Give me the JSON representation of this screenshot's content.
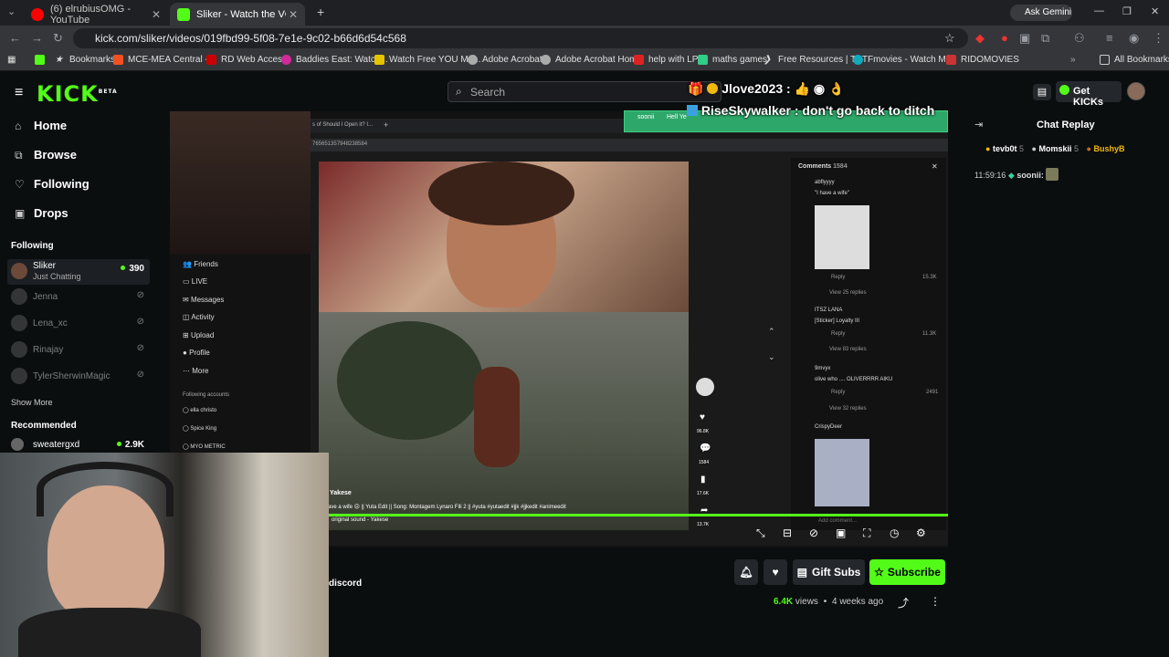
{
  "browser": {
    "tabs": [
      {
        "title": "(6) elrubiusOMG - YouTube",
        "active": false
      },
      {
        "title": "Sliker - Watch the VOD on",
        "active": true
      }
    ],
    "ask_gemini": "Ask Gemini",
    "url": "kick.com/sliker/videos/019fbd99-5f08-7e1e-9c02-b66d6d54c568",
    "bookmarks": [
      "Bookmarks",
      "MCE-MEA Central -...",
      "RD Web Access",
      "Baddies East: Watch...",
      "Watch Free YOU Mo...",
      "Adobe Acrobat",
      "Adobe Acrobat Home",
      "help with LP",
      "maths games",
      "Free Resources | TPT",
      "Fmovies - Watch M...",
      "RIDOMOVIES"
    ],
    "all_bookmarks": "All Bookmarks"
  },
  "kick": {
    "logo": "KICK",
    "logo_beta": "BETA",
    "search_placeholder": "Search",
    "get_kicks": "Get KICKs",
    "nav": [
      "Home",
      "Browse",
      "Following",
      "Drops"
    ],
    "following_heading": "Following",
    "following": [
      {
        "name": "Sliker",
        "sub": "Just Chatting",
        "count": "390",
        "live": true
      },
      {
        "name": "Jenna",
        "sub": "",
        "count": "",
        "live": false
      },
      {
        "name": "Lena_xc",
        "sub": "",
        "count": "",
        "live": false
      },
      {
        "name": "Rinajay",
        "sub": "",
        "count": "",
        "live": false
      },
      {
        "name": "TylerSherwinMagic",
        "sub": "",
        "count": "",
        "live": false
      }
    ],
    "show_more": "Show More",
    "recommended_heading": "Recommended",
    "recommended": [
      {
        "name": "sweatergxd",
        "count": "2.9K"
      }
    ]
  },
  "overlay": {
    "line1": "Jlove2023 :",
    "line2": "RiseSkywalker : don't go back to ditch"
  },
  "inner_page": {
    "url": "765651357948238584",
    "tab": "s of Should I Open it? I...",
    "nav": [
      "Friends",
      "LIVE",
      "Messages",
      "Activity",
      "Upload",
      "Profile",
      "More"
    ],
    "following_accounts": "Following accounts",
    "accounts": [
      "ella christo",
      "Spice King",
      "MYO METRIC"
    ],
    "caption_user": "Yakese",
    "caption": "ave a wife ☹ || Yuta Edit || Song: Montagem Lynaro Fili 2 || #yuta #yutaedit #jjk #jjkedit #animeedit",
    "sound": "original sound - Yakese",
    "actions": [
      "96.8K",
      "1584",
      "17.6K",
      "13.7K"
    ],
    "comments_title": "Comments",
    "comments_count": "1584",
    "comments": [
      {
        "user": "abflyyyy",
        "text": "\"I have a wife\"",
        "likes": "15.3K",
        "replies": "View 25 replies"
      },
      {
        "user": "ITSZ LANA",
        "text": "[Sticker] Loyalty III",
        "likes": "11.3K",
        "replies": "View 83 replies"
      },
      {
        "user": "9mvyx",
        "text": "olive who .... OLIVERRRR AIKU",
        "likes": "2491",
        "replies": "View 32 replies"
      },
      {
        "user": "CrispyDeer",
        "text": "",
        "likes": "",
        "replies": ""
      }
    ],
    "reply": "Reply",
    "add_comment": "Add comment...",
    "sticker_user": "soonii",
    "sticker_text": "Hell Ye"
  },
  "below": {
    "discord": "discord",
    "gift_subs": "Gift Subs",
    "subscribe": "Subscribe",
    "views": "6.4K",
    "views_label": "views",
    "age": "4 weeks ago"
  },
  "chat": {
    "title": "Chat Replay",
    "top_users": [
      {
        "name": "tevb0t",
        "n": "5"
      },
      {
        "name": "Momskii",
        "n": "5"
      },
      {
        "name": "BushyB",
        "n": ""
      }
    ],
    "time": "11:59:16",
    "user": "soonii:"
  },
  "colors": {
    "accent": "#53fc18",
    "bg": "#0b0e0f"
  }
}
